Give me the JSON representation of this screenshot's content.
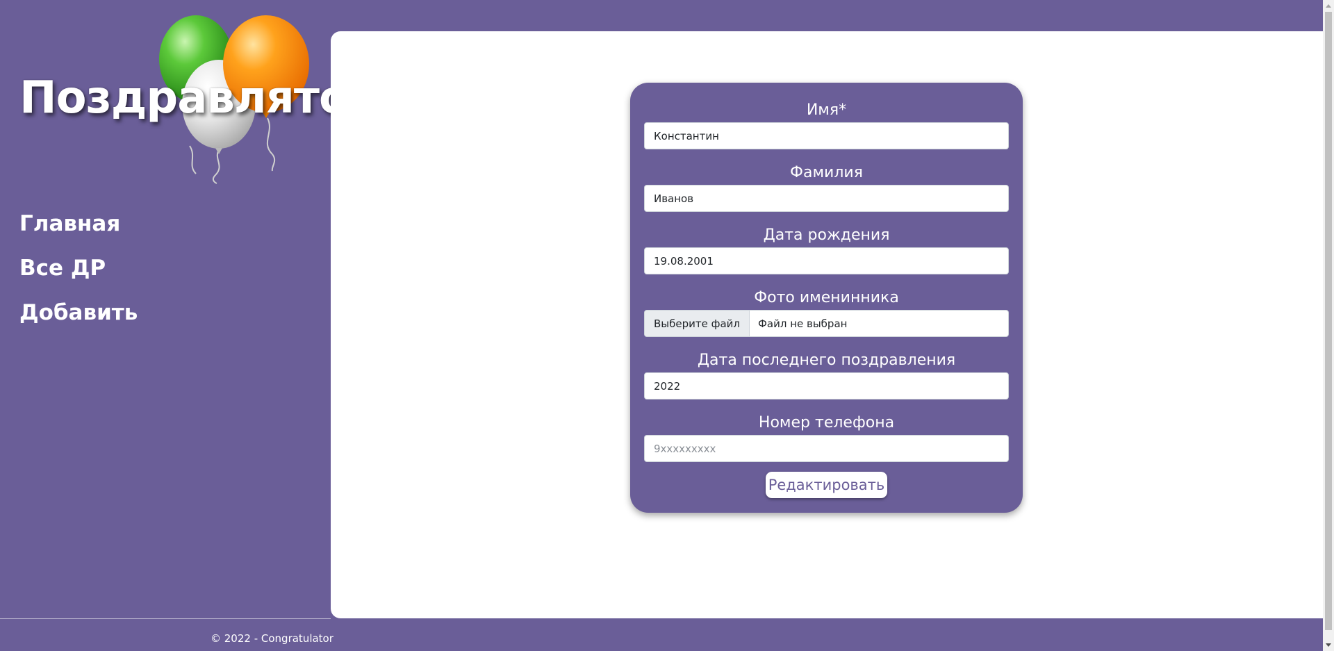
{
  "app": {
    "logo_text": "Поздравлятор",
    "colors": {
      "primary": "#6a5e98",
      "panel": "#ffffff",
      "balloon_green": "#3fae2a",
      "balloon_white": "#e8e8e8",
      "balloon_orange": "#ff9a1a"
    }
  },
  "nav": {
    "items": [
      {
        "label": "Главная"
      },
      {
        "label": "Все ДР"
      },
      {
        "label": "Добавить"
      }
    ]
  },
  "form": {
    "first_name": {
      "label": "Имя*",
      "value": "Константин"
    },
    "last_name": {
      "label": "Фамилия",
      "value": "Иванов"
    },
    "birth_date": {
      "label": "Дата рождения",
      "value": "19.08.2001"
    },
    "photo": {
      "label": "Фото именинника",
      "button_label": "Выберите файл",
      "status": "Файл не выбран"
    },
    "last_congrat": {
      "label": "Дата последнего поздравления",
      "value": "2022"
    },
    "phone": {
      "label": "Номер телефона",
      "value": "",
      "placeholder": "9xxxxxxxxx"
    },
    "submit_label": "Редактировать"
  },
  "footer": {
    "text": "© 2022 - Congratulator"
  }
}
